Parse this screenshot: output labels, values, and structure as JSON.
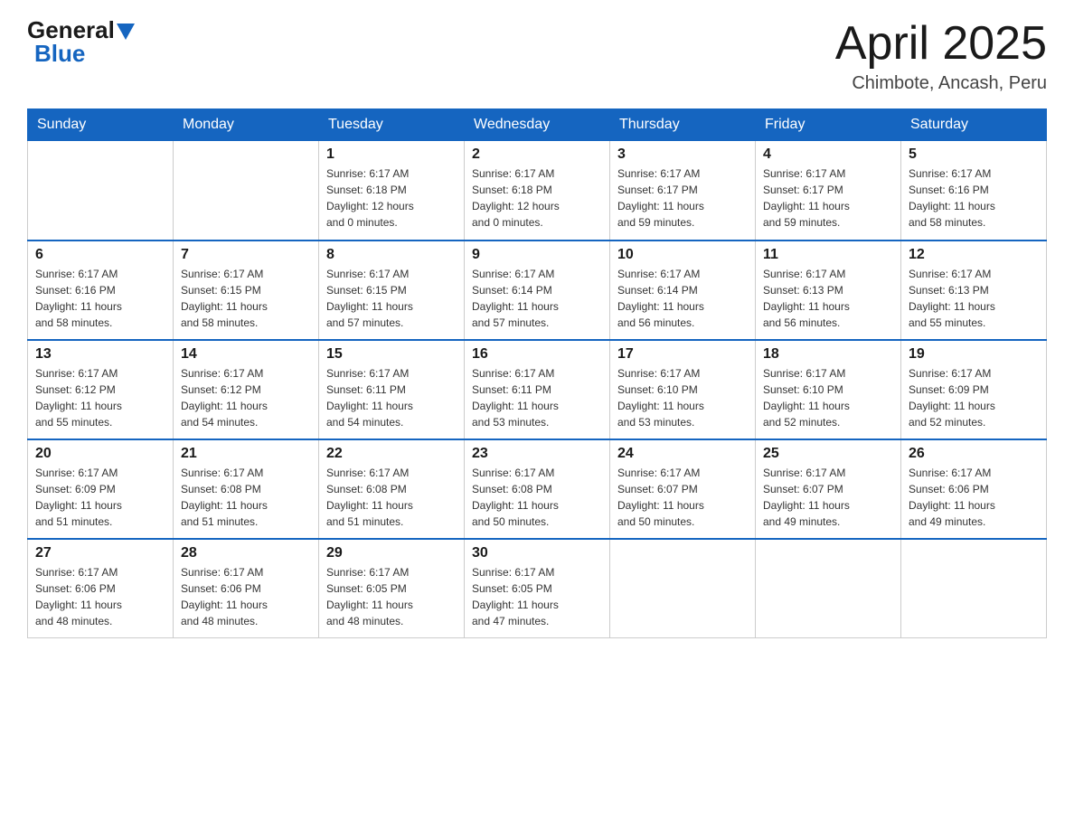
{
  "header": {
    "logo_general": "General",
    "logo_blue": "Blue",
    "title": "April 2025",
    "subtitle": "Chimbote, Ancash, Peru"
  },
  "days_of_week": [
    "Sunday",
    "Monday",
    "Tuesday",
    "Wednesday",
    "Thursday",
    "Friday",
    "Saturday"
  ],
  "weeks": [
    [
      {
        "day": "",
        "info": ""
      },
      {
        "day": "",
        "info": ""
      },
      {
        "day": "1",
        "info": "Sunrise: 6:17 AM\nSunset: 6:18 PM\nDaylight: 12 hours\nand 0 minutes."
      },
      {
        "day": "2",
        "info": "Sunrise: 6:17 AM\nSunset: 6:18 PM\nDaylight: 12 hours\nand 0 minutes."
      },
      {
        "day": "3",
        "info": "Sunrise: 6:17 AM\nSunset: 6:17 PM\nDaylight: 11 hours\nand 59 minutes."
      },
      {
        "day": "4",
        "info": "Sunrise: 6:17 AM\nSunset: 6:17 PM\nDaylight: 11 hours\nand 59 minutes."
      },
      {
        "day": "5",
        "info": "Sunrise: 6:17 AM\nSunset: 6:16 PM\nDaylight: 11 hours\nand 58 minutes."
      }
    ],
    [
      {
        "day": "6",
        "info": "Sunrise: 6:17 AM\nSunset: 6:16 PM\nDaylight: 11 hours\nand 58 minutes."
      },
      {
        "day": "7",
        "info": "Sunrise: 6:17 AM\nSunset: 6:15 PM\nDaylight: 11 hours\nand 58 minutes."
      },
      {
        "day": "8",
        "info": "Sunrise: 6:17 AM\nSunset: 6:15 PM\nDaylight: 11 hours\nand 57 minutes."
      },
      {
        "day": "9",
        "info": "Sunrise: 6:17 AM\nSunset: 6:14 PM\nDaylight: 11 hours\nand 57 minutes."
      },
      {
        "day": "10",
        "info": "Sunrise: 6:17 AM\nSunset: 6:14 PM\nDaylight: 11 hours\nand 56 minutes."
      },
      {
        "day": "11",
        "info": "Sunrise: 6:17 AM\nSunset: 6:13 PM\nDaylight: 11 hours\nand 56 minutes."
      },
      {
        "day": "12",
        "info": "Sunrise: 6:17 AM\nSunset: 6:13 PM\nDaylight: 11 hours\nand 55 minutes."
      }
    ],
    [
      {
        "day": "13",
        "info": "Sunrise: 6:17 AM\nSunset: 6:12 PM\nDaylight: 11 hours\nand 55 minutes."
      },
      {
        "day": "14",
        "info": "Sunrise: 6:17 AM\nSunset: 6:12 PM\nDaylight: 11 hours\nand 54 minutes."
      },
      {
        "day": "15",
        "info": "Sunrise: 6:17 AM\nSunset: 6:11 PM\nDaylight: 11 hours\nand 54 minutes."
      },
      {
        "day": "16",
        "info": "Sunrise: 6:17 AM\nSunset: 6:11 PM\nDaylight: 11 hours\nand 53 minutes."
      },
      {
        "day": "17",
        "info": "Sunrise: 6:17 AM\nSunset: 6:10 PM\nDaylight: 11 hours\nand 53 minutes."
      },
      {
        "day": "18",
        "info": "Sunrise: 6:17 AM\nSunset: 6:10 PM\nDaylight: 11 hours\nand 52 minutes."
      },
      {
        "day": "19",
        "info": "Sunrise: 6:17 AM\nSunset: 6:09 PM\nDaylight: 11 hours\nand 52 minutes."
      }
    ],
    [
      {
        "day": "20",
        "info": "Sunrise: 6:17 AM\nSunset: 6:09 PM\nDaylight: 11 hours\nand 51 minutes."
      },
      {
        "day": "21",
        "info": "Sunrise: 6:17 AM\nSunset: 6:08 PM\nDaylight: 11 hours\nand 51 minutes."
      },
      {
        "day": "22",
        "info": "Sunrise: 6:17 AM\nSunset: 6:08 PM\nDaylight: 11 hours\nand 51 minutes."
      },
      {
        "day": "23",
        "info": "Sunrise: 6:17 AM\nSunset: 6:08 PM\nDaylight: 11 hours\nand 50 minutes."
      },
      {
        "day": "24",
        "info": "Sunrise: 6:17 AM\nSunset: 6:07 PM\nDaylight: 11 hours\nand 50 minutes."
      },
      {
        "day": "25",
        "info": "Sunrise: 6:17 AM\nSunset: 6:07 PM\nDaylight: 11 hours\nand 49 minutes."
      },
      {
        "day": "26",
        "info": "Sunrise: 6:17 AM\nSunset: 6:06 PM\nDaylight: 11 hours\nand 49 minutes."
      }
    ],
    [
      {
        "day": "27",
        "info": "Sunrise: 6:17 AM\nSunset: 6:06 PM\nDaylight: 11 hours\nand 48 minutes."
      },
      {
        "day": "28",
        "info": "Sunrise: 6:17 AM\nSunset: 6:06 PM\nDaylight: 11 hours\nand 48 minutes."
      },
      {
        "day": "29",
        "info": "Sunrise: 6:17 AM\nSunset: 6:05 PM\nDaylight: 11 hours\nand 48 minutes."
      },
      {
        "day": "30",
        "info": "Sunrise: 6:17 AM\nSunset: 6:05 PM\nDaylight: 11 hours\nand 47 minutes."
      },
      {
        "day": "",
        "info": ""
      },
      {
        "day": "",
        "info": ""
      },
      {
        "day": "",
        "info": ""
      }
    ]
  ]
}
